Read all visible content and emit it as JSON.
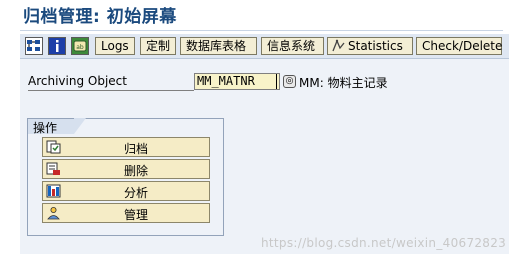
{
  "title": "归档管理: 初始屏幕",
  "toolbar": {
    "icons": [
      "hierarchy-icon",
      "info-icon",
      "customizing-icon"
    ],
    "buttons": [
      "Logs",
      "定制",
      "数据库表格",
      "信息系统",
      "Statistics",
      "Check/Delete"
    ]
  },
  "form": {
    "archiving_object_label": "Archiving Object",
    "archiving_object_value": "MM_MATNR",
    "archiving_object_desc": "MM: 物料主记录"
  },
  "actions": {
    "header": "操作",
    "items": [
      "归档",
      "删除",
      "分析",
      "管理"
    ]
  },
  "watermark": "https://blog.csdn.net/weixin_40672823"
}
